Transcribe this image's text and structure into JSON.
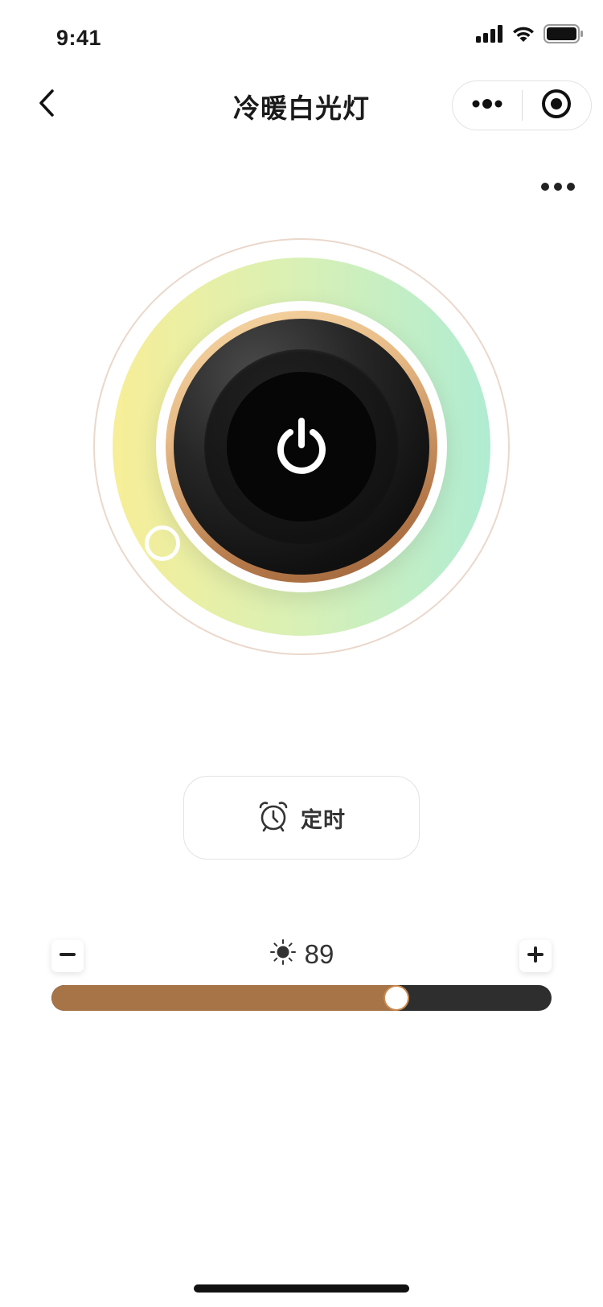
{
  "status_bar": {
    "time": "9:41",
    "icons": [
      "signal-icon",
      "wifi-icon",
      "battery-icon"
    ]
  },
  "nav": {
    "back_icon": "chevron-left-icon",
    "title": "冷暖白光灯",
    "capsule": {
      "menu_icon": "more-dots-icon",
      "close_icon": "target-circle-icon"
    }
  },
  "more_button": {
    "icon": "more-dots-icon"
  },
  "dial": {
    "power_icon": "power-icon",
    "ring_colors": [
      "#f7ee97",
      "#d8f0b6",
      "#b0ecd2"
    ],
    "accent_gold": "#b5794a"
  },
  "timer": {
    "icon": "alarm-clock-icon",
    "label": "定时"
  },
  "brightness": {
    "icon": "sun-icon",
    "value": "89",
    "level_percent": 69,
    "minus_label": "−",
    "plus_label": "+",
    "fill_color": "#a67447",
    "track_color": "#2e2e2e"
  }
}
